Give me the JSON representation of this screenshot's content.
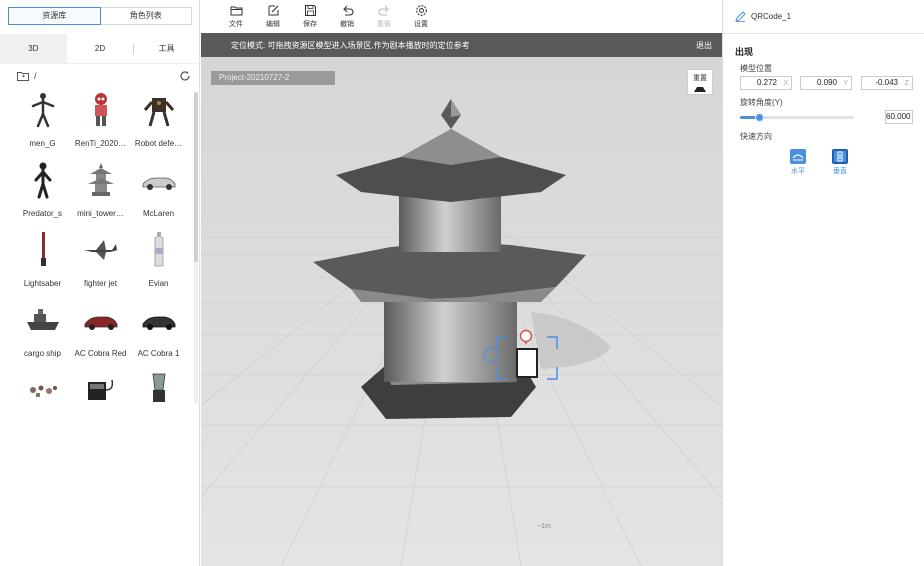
{
  "left": {
    "tabs": [
      "资源库",
      "角色列表"
    ],
    "subtabs": [
      "3D",
      "2D",
      "工具"
    ],
    "path": "/",
    "items": [
      {
        "label": "men_G"
      },
      {
        "label": "RenTi_2020…"
      },
      {
        "label": "Robot defe…"
      },
      {
        "label": "Predator_s"
      },
      {
        "label": "mini_tower…"
      },
      {
        "label": "McLaren"
      },
      {
        "label": "Lightsaber"
      },
      {
        "label": "fighter jet"
      },
      {
        "label": "Evian"
      },
      {
        "label": "cargo ship"
      },
      {
        "label": "AC Cobra Red"
      },
      {
        "label": "AC Cobra 1"
      },
      {
        "label": ""
      },
      {
        "label": ""
      },
      {
        "label": ""
      }
    ]
  },
  "toolbar": {
    "file": "文件",
    "edit": "编辑",
    "save": "保存",
    "undo": "撤销",
    "redo": "重做",
    "settings": "设置"
  },
  "modebar": {
    "text": "定位模式: 可拖拽资源区模型进入场景区,作为剧本播放时的定位参考",
    "exit": "退出"
  },
  "viewport": {
    "project": "Project-20210727-2",
    "reset": "重置",
    "scale": "~1m"
  },
  "right": {
    "object_name": "QRCode_1",
    "section": "出现",
    "position_label": "模型位置",
    "x": "0.272",
    "y": "0.090",
    "z": "-0.043",
    "axis_x": "X",
    "axis_y": "Y",
    "axis_z": "Z",
    "rotation_label": "旋转角度(Y)",
    "rotation_value": "60.000",
    "rotation_fraction": 0.17,
    "direction_label": "快速方向",
    "horizontal": "水平",
    "vertical": "垂直"
  },
  "colors": {
    "accent": "#4a90e2",
    "modebar": "#595959",
    "viewport_bg": "#dedede"
  }
}
